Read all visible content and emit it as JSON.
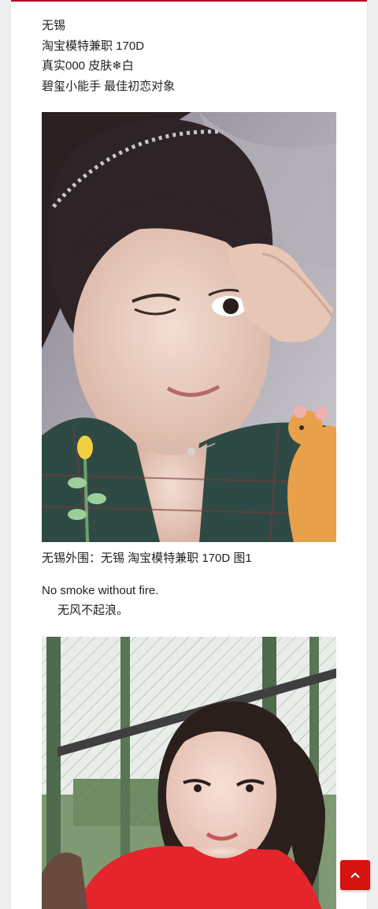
{
  "post": {
    "lines": [
      "无锡",
      "淘宝模特兼职 170D",
      "真实000 皮肤❄白",
      "碧玺小能手 最佳初恋对象"
    ],
    "caption": "无锡外围：无锡 淘宝模特兼职 170D 图1",
    "quote_en": "No smoke without fire.",
    "quote_zh": "无风不起浪。"
  },
  "images": {
    "photo1": "selfie-photo",
    "photo2": "outdoor-photo"
  },
  "back_to_top": {
    "icon": "chevron-up-icon"
  },
  "colors": {
    "accent": "#d5140f",
    "top_border": "#b8001f",
    "card": "#ffffff",
    "background": "#eeeeee"
  }
}
